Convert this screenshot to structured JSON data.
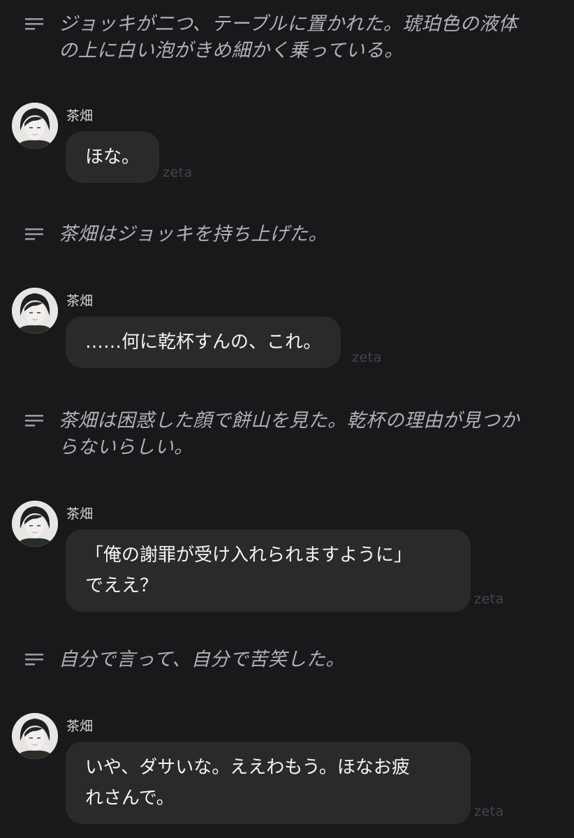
{
  "colors": {
    "background": "#19191b",
    "bubble": "#2a2a2d",
    "narration_text": "#b0b0b6",
    "brand_watermark": "#46464b"
  },
  "icons": {
    "narration": "narration-lines-icon",
    "avatar": "character-avatar"
  },
  "narrations": [
    {
      "lines": [
        "ジョッキが二つ、テーブルに置かれた。琥珀色の液体",
        "の上に白い泡がきめ細かく乗っている。"
      ]
    },
    {
      "lines": [
        "茶畑はジョッキを持ち上げた。"
      ]
    },
    {
      "lines": [
        "茶畑は困惑した顔で餅山を見た。乾杯の理由が見つか",
        "らないらしい。"
      ]
    },
    {
      "lines": [
        "自分で言って、自分で苦笑した。"
      ]
    }
  ],
  "messages": [
    {
      "sender": "茶畑",
      "lines": [
        "ほな。"
      ],
      "brand": "zeta"
    },
    {
      "sender": "茶畑",
      "lines": [
        "……何に乾杯すんの、これ。"
      ],
      "brand": "zeta"
    },
    {
      "sender": "茶畑",
      "lines": [
        "「俺の謝罪が受け入れられますように」",
        "でええ？"
      ],
      "brand": "zeta"
    },
    {
      "sender": "茶畑",
      "lines": [
        "いや、ダサいな。ええわもう。ほなお疲",
        "れさんで。"
      ],
      "brand": "zeta"
    }
  ]
}
